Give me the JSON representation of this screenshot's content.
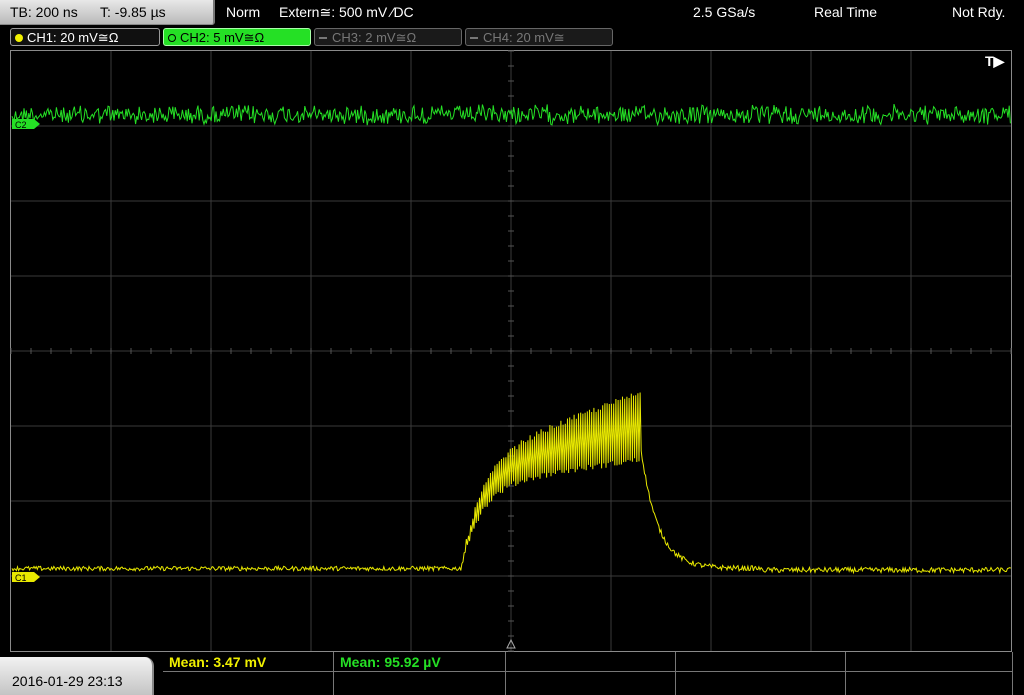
{
  "status": {
    "timebase": "TB: 200 ns",
    "trigger_time": "T: -9.85 µs",
    "trigger_mode": "Norm",
    "trigger_source": "Extern≅: 500 mV ⁄DC",
    "sample_rate": "2.5 GSa/s",
    "acq_mode": "Real Time",
    "acq_state": "Not Rdy."
  },
  "channels": [
    {
      "label": "CH1: 20 mV≅Ω",
      "color": "#f0f000",
      "active": true
    },
    {
      "label": "CH2: 5 mV≅Ω",
      "color": "#25e025",
      "active": true
    },
    {
      "label": "CH3: 2 mV≅Ω",
      "color": "#777777",
      "active": false
    },
    {
      "label": "CH4: 20 mV≅",
      "color": "#777777",
      "active": false
    }
  ],
  "trigger_marker": "T▶",
  "ground_markers": {
    "ch2": "C2",
    "ch1": "C1"
  },
  "datetime": "2016-01-29 23:13",
  "measurements": [
    {
      "label": "Mean: 3.47 mV",
      "color": "#f0f000"
    },
    {
      "label": "Mean: 95.92 µV",
      "color": "#25e025"
    }
  ],
  "traces": {
    "ch2": {
      "color": "#25e025",
      "level_div": 3.15,
      "noise_div": 0.12
    },
    "ch1": {
      "color": "#e8e800",
      "baseline_div": -2.9,
      "pulse_start_div": -0.5,
      "pulse_end_div": 1.3,
      "pulse_low_div": -1.8,
      "pulse_high_div": -1.2,
      "tail_div": -2.8
    }
  }
}
